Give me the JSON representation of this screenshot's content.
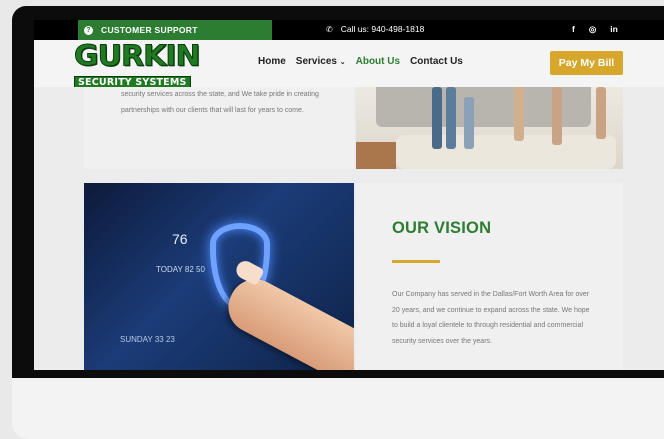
{
  "topbar": {
    "support_label": "CUSTOMER SUPPORT",
    "phone_label": "Call us: 940-498-1818",
    "social_icons": [
      "facebook-icon",
      "instagram-icon",
      "linkedin-icon"
    ],
    "social_glyphs": [
      "f",
      "◎",
      "in"
    ]
  },
  "header": {
    "logo_top": "GURKIN",
    "logo_bottom": "SECURITY SYSTEMS",
    "nav": [
      "Home",
      "Services",
      "About Us",
      "Contact Us"
    ],
    "active_nav": "About Us",
    "pay_button": "Pay My Bill"
  },
  "about": {
    "text": "security services across the state, and We take pride in creating partnerships with our clients that will last for years to come."
  },
  "tablet": {
    "temp": "76",
    "day_label": "TODAY",
    "sub_values": "82  50",
    "bottom_values": "SUNDAY  33  23"
  },
  "vision": {
    "title": "OUR VISION",
    "text": "Our Company has served in the Dallas/Fort Worth Area for over 20 years, and we continue to expand across the state. We hope to build a loyal clientele to through residential and commercial security services over the years."
  },
  "colors": {
    "brand_green": "#2c7d31",
    "accent_gold": "#d6a72a"
  }
}
